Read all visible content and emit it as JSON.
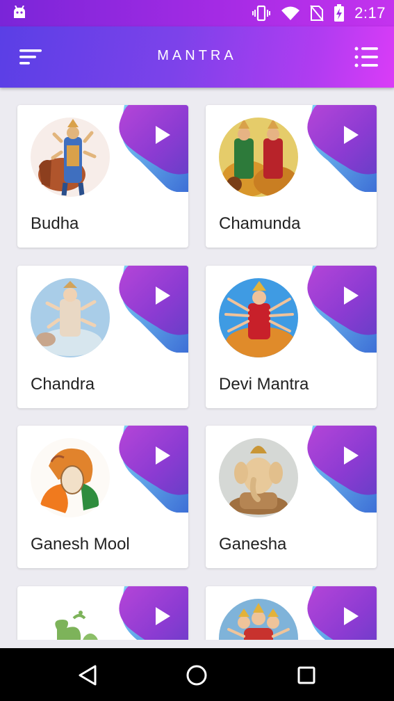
{
  "status_bar": {
    "time": "2:17"
  },
  "app_bar": {
    "title": "MANTRA",
    "menu_icon": "sort-menu-icon",
    "list_icon": "list-icon"
  },
  "mantras": [
    {
      "name": "Budha",
      "image": "deity-on-elephant"
    },
    {
      "name": "Chamunda",
      "image": "goddess-pair-on-lion"
    },
    {
      "name": "Chandra",
      "image": "moon-deity"
    },
    {
      "name": "Devi Mantra",
      "image": "durga-on-tiger"
    },
    {
      "name": "Ganesh Mool",
      "image": "ganesh-drawing"
    },
    {
      "name": "Ganesha",
      "image": "ganesha-statue"
    },
    {
      "name": "",
      "image": "om-ganesh"
    },
    {
      "name": "",
      "image": "multi-faced-deity"
    }
  ],
  "colors": {
    "accent_start": "#5a3fe6",
    "accent_end": "#da3cf7",
    "background": "#ecebf1"
  }
}
